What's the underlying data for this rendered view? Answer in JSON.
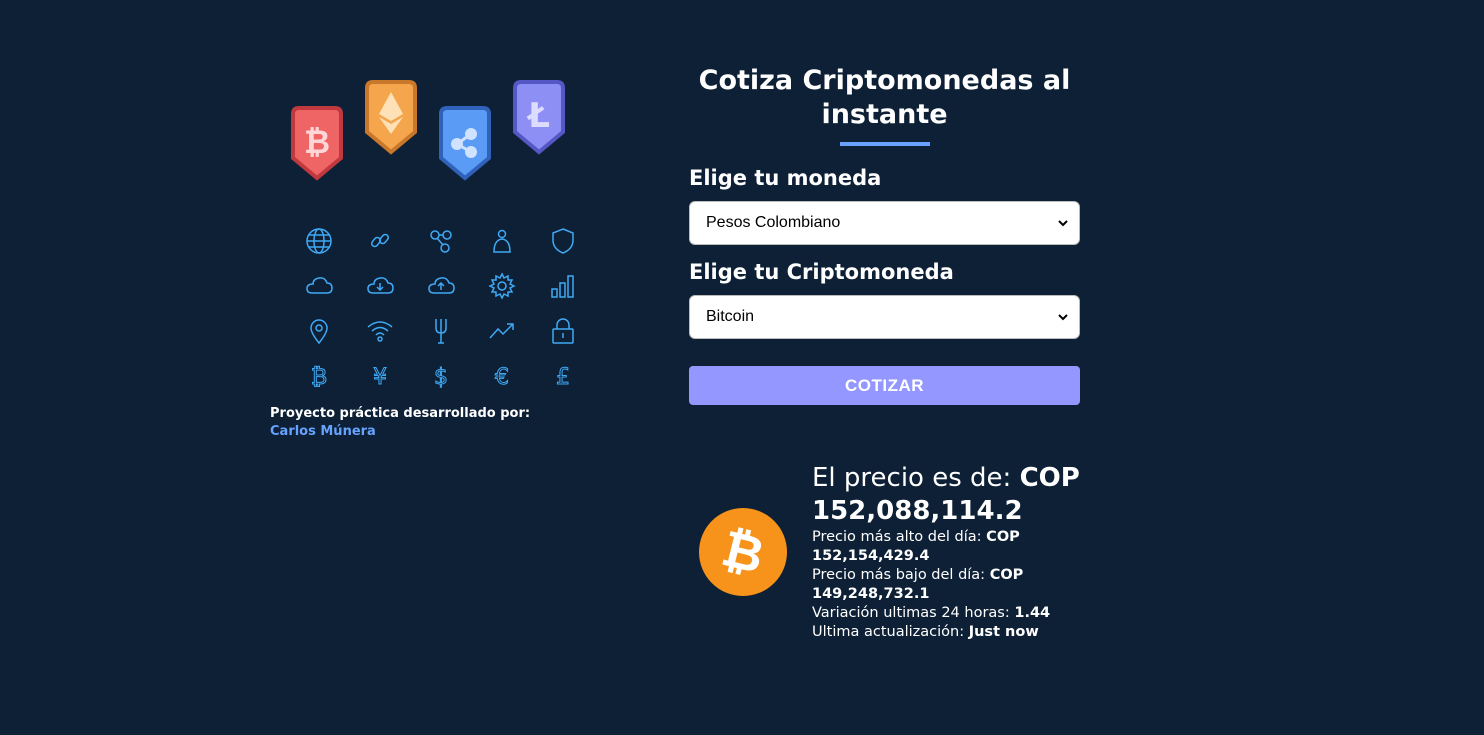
{
  "credit": {
    "line1": "Proyecto práctica desarrollado por:",
    "author": "Carlos Múnera"
  },
  "header": {
    "title": "Cotiza Criptomonedas al instante"
  },
  "form": {
    "currency_label": "Elige tu moneda",
    "currency_value": "Pesos Colombiano",
    "crypto_label": "Elige tu Criptomoneda",
    "crypto_value": "Bitcoin",
    "submit_label": "COTIZAR"
  },
  "result": {
    "price_prefix": "El precio es de: ",
    "price_value": "COP 152,088,114.2",
    "high_label": "Precio más alto del día: ",
    "high_value": "COP 152,154,429.4",
    "low_label": "Precio más bajo del día: ",
    "low_value": "COP 149,248,732.1",
    "change_label": "Variación ultimas 24 horas: ",
    "change_value": "1.44",
    "updated_label": "Ultima actualización: ",
    "updated_value": "Just now"
  },
  "colors": {
    "background": "#0d2035",
    "accent": "#66a2fe",
    "button": "#9497ff",
    "bitcoin": "#f7931a"
  },
  "icons": [
    "globe-icon",
    "chain-link-icon",
    "network-nodes-icon",
    "wallet-user-icon",
    "shield-icon",
    "cloud-icon",
    "cloud-download-icon",
    "cloud-upload-icon",
    "gear-icon",
    "bar-chart-icon",
    "location-pin-icon",
    "wifi-icon",
    "fork-icon",
    "trend-up-icon",
    "padlock-icon",
    "bitcoin-symbol-icon",
    "yen-icon",
    "dollar-icon",
    "euro-icon",
    "pound-icon"
  ]
}
